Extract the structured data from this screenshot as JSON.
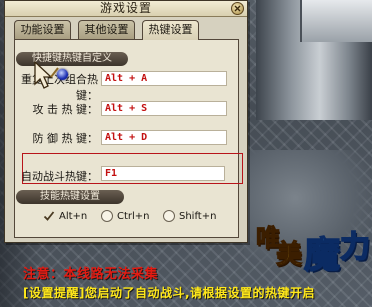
{
  "dialog": {
    "title": "游戏设置",
    "tabs": [
      {
        "label": "功能设置",
        "active": false
      },
      {
        "label": "其他设置",
        "active": false
      },
      {
        "label": "热键设置",
        "active": true
      }
    ]
  },
  "hotkeys": {
    "header": "快捷键热键自定义",
    "rows": [
      {
        "label": "重复上次组合热键：",
        "value": "Alt + A"
      },
      {
        "label": "攻 击 热 键：",
        "value": "Alt + S"
      },
      {
        "label": "防 御 热 键：",
        "value": "Alt + D"
      },
      {
        "label": "自动战斗热键：",
        "value": "F1"
      }
    ]
  },
  "skill_hotkeys": {
    "header": "技能热键设置",
    "options": [
      {
        "label": "Alt+n",
        "checked": true
      },
      {
        "label": "Ctrl+n",
        "checked": false
      },
      {
        "label": "Shift+n",
        "checked": false
      }
    ]
  },
  "notices": {
    "warning": "注意：本线路无法采集",
    "reminder": "[设置提醒]您启动了自动战斗,请根据设置的热键开启"
  },
  "logo": {
    "text": "唯美魔力"
  },
  "colors": {
    "warning": "#e41b12",
    "reminder": "#ffe81a",
    "hotkey_text": "#c31010",
    "highlight_border": "#b8141a"
  },
  "icons": {
    "close": "close-icon",
    "cursor": "sword-cursor-icon",
    "checkmark": "checkmark-icon",
    "orb": "blue-orb-icon"
  }
}
